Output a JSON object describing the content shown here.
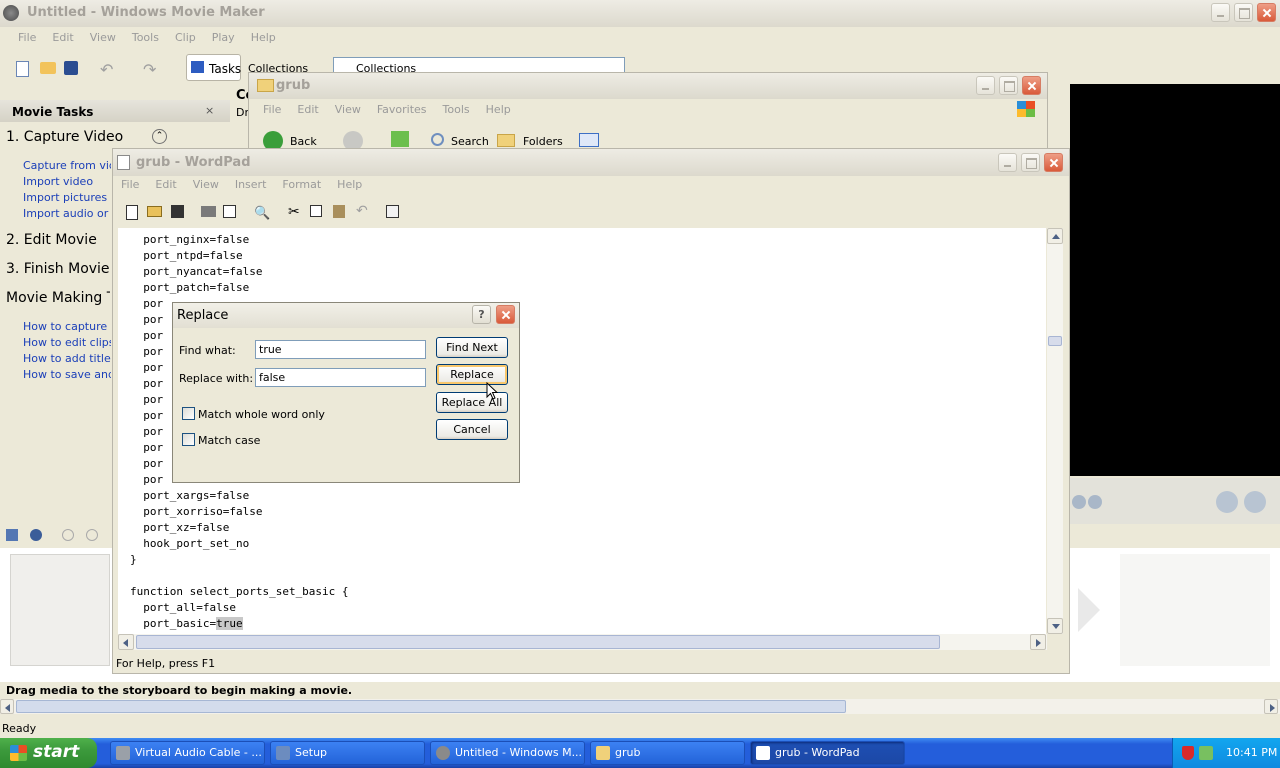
{
  "moviemaker": {
    "title": "Untitled - Windows Movie Maker",
    "menu": [
      "File",
      "Edit",
      "View",
      "Tools",
      "Clip",
      "Play",
      "Help"
    ],
    "tasks_button": "Tasks",
    "collections_button": "Collections",
    "collections_dropdown": "Collections",
    "panel_title": "Movie Tasks",
    "pane_title_fragment": "Co",
    "pane_sub_fragment": "Dr",
    "sections": {
      "capture": "1. Capture Video",
      "edit": "2. Edit Movie",
      "finish": "3. Finish Movie",
      "tips": "Movie Making T"
    },
    "capture_links": [
      "Capture from video device",
      "Import video",
      "Import pictures",
      "Import audio or music"
    ],
    "tips_links": [
      "How to capture video",
      "How to edit clips",
      "How to add titles, effects",
      "How to save and share"
    ],
    "storyboard_hint": "Drag media to the storyboard to begin making a movie.",
    "status": "Ready"
  },
  "explorer": {
    "title": "grub",
    "menu": [
      "File",
      "Edit",
      "View",
      "Favorites",
      "Tools",
      "Help"
    ],
    "back": "Back",
    "search": "Search",
    "folders": "Folders"
  },
  "wordpad": {
    "title": "grub - WordPad",
    "menu": [
      "File",
      "Edit",
      "View",
      "Insert",
      "Format",
      "Help"
    ],
    "status": "For Help, press F1",
    "lines_top": [
      "  port_nginx=false",
      "  port_ntpd=false",
      "  port_nyancat=false",
      "  port_patch=false"
    ],
    "partial_prefix": "  por",
    "partial_count": 12,
    "lines_bottom": [
      "  port_xargs=false",
      "  port_xorriso=false",
      "  port_xz=false",
      "  hook_port_set_no",
      "}",
      "",
      "function select_ports_set_basic {",
      "  port_all=false"
    ],
    "last_line_prefix": "  port_basic=",
    "last_line_selected": "true"
  },
  "replace_dialog": {
    "title": "Replace",
    "help_btn": "?",
    "find_label": "Find what:",
    "find_value": "true",
    "replace_label": "Replace with:",
    "replace_value": "false",
    "match_whole": "Match whole word only",
    "match_case": "Match case",
    "btn_find_next": "Find Next",
    "btn_replace": "Replace",
    "btn_replace_all": "Replace All",
    "btn_cancel": "Cancel"
  },
  "taskbar": {
    "start": "start",
    "items": [
      {
        "label": "Virtual Audio Cable - ...",
        "active": false
      },
      {
        "label": "Setup",
        "active": false
      },
      {
        "label": "Untitled - Windows M...",
        "active": false
      },
      {
        "label": "grub",
        "active": false
      },
      {
        "label": "grub - WordPad",
        "active": true
      }
    ],
    "clock": "10:41 PM"
  },
  "colors": {
    "xp_blue": "#245edb",
    "start_green": "#3c9a3c",
    "tray": "#0f8ae0"
  }
}
